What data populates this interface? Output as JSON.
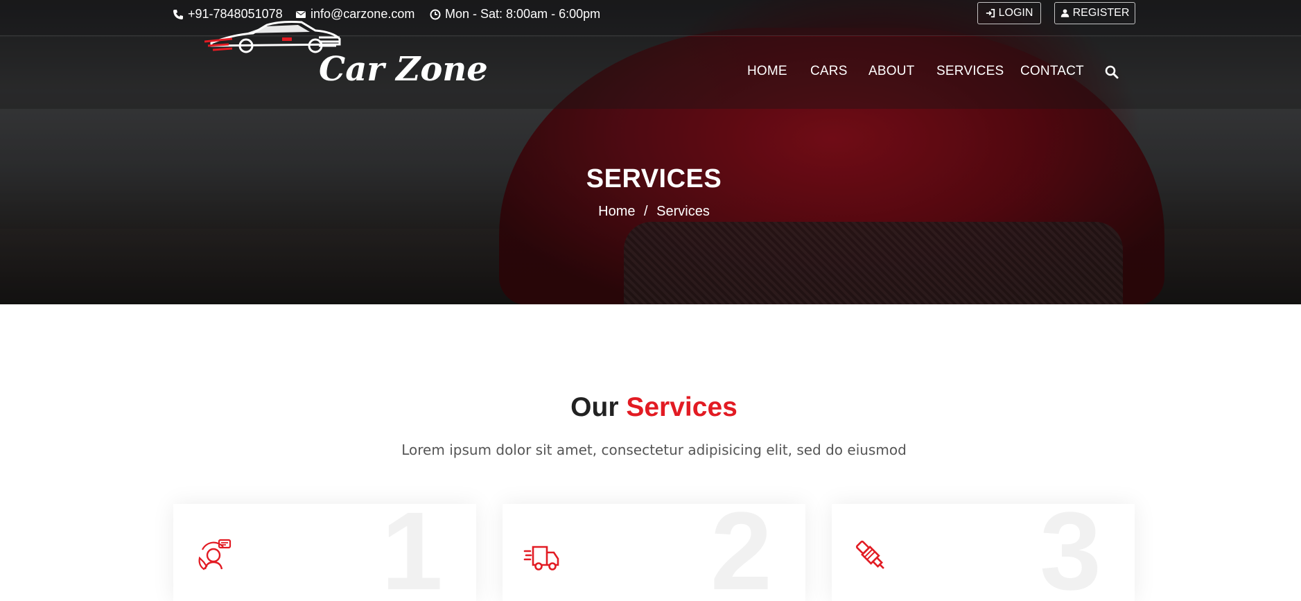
{
  "brand": {
    "name": "Car Zone",
    "accent": "#e21b23"
  },
  "topbar": {
    "phone": "+91-7848051078",
    "email": "info@carzone.com",
    "hours": "Mon - Sat: 8:00am - 6:00pm",
    "login": "LOGIN",
    "register": "REGISTER"
  },
  "nav": {
    "items": [
      {
        "label": "HOME"
      },
      {
        "label": "CARS"
      },
      {
        "label": "ABOUT"
      },
      {
        "label": "SERVICES"
      },
      {
        "label": "CONTACT"
      }
    ],
    "search_icon": "search-icon"
  },
  "hero": {
    "title": "SERVICES",
    "breadcrumb": {
      "home": "Home",
      "separator": "/",
      "current": "Services"
    }
  },
  "section": {
    "title_part1": "Our",
    "title_part2": "Services",
    "subtitle": "Lorem ipsum dolor sit amet, consectetur adipisicing elit, sed do eiusmod"
  },
  "cards": [
    {
      "number": "1",
      "icon": "customer-support-icon"
    },
    {
      "number": "2",
      "icon": "delivery-truck-icon"
    },
    {
      "number": "3",
      "icon": "spark-plug-icon"
    }
  ]
}
